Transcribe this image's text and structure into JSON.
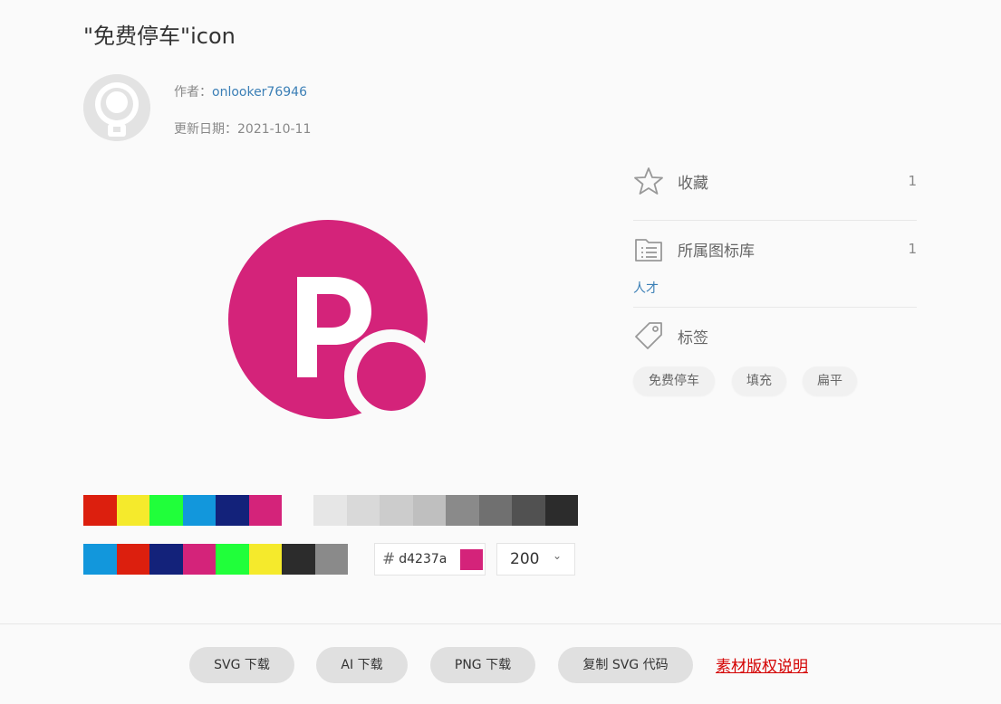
{
  "page": {
    "title": "\"免费停车\"icon"
  },
  "author": {
    "label": "作者：",
    "name": "onlooker76946"
  },
  "updated": {
    "label": "更新日期：",
    "date": "2021-10-11"
  },
  "icon": {
    "color": "#d4237a",
    "letter": "P"
  },
  "sidebar": {
    "favorite": {
      "label": "收藏",
      "count": "1"
    },
    "library": {
      "label": "所属图标库",
      "count": "1",
      "link": "人才"
    },
    "tags": {
      "label": "标签",
      "items": [
        "免费停车",
        "填充",
        "扁平"
      ]
    }
  },
  "palette": {
    "vivid": [
      "#dc1f0e",
      "#f5ea2c",
      "#20ff3a",
      "#1297dc",
      "#13227a",
      "#d4237a"
    ],
    "grays": [
      "#e6e6e6",
      "#d9d9d9",
      "#cccccc",
      "#bfbfbf",
      "#8a8a8a",
      "#707070",
      "#515151",
      "#2c2c2c"
    ],
    "recent": [
      "#1297dc",
      "#dc1f0e",
      "#13227a",
      "#d4237a",
      "#20ff3a",
      "#f5ea2c",
      "#2c2c2c",
      "#8a8a8a"
    ]
  },
  "color_input": {
    "hash": "#",
    "value": "d4237a",
    "swatch": "#d4237a"
  },
  "size_select": {
    "value": "200",
    "chevron": "⌄"
  },
  "footer": {
    "svg_download": "SVG 下载",
    "ai_download": "AI 下载",
    "png_download": "PNG 下载",
    "copy_svg": "复制 SVG 代码",
    "copyright": "素材版权说明"
  }
}
